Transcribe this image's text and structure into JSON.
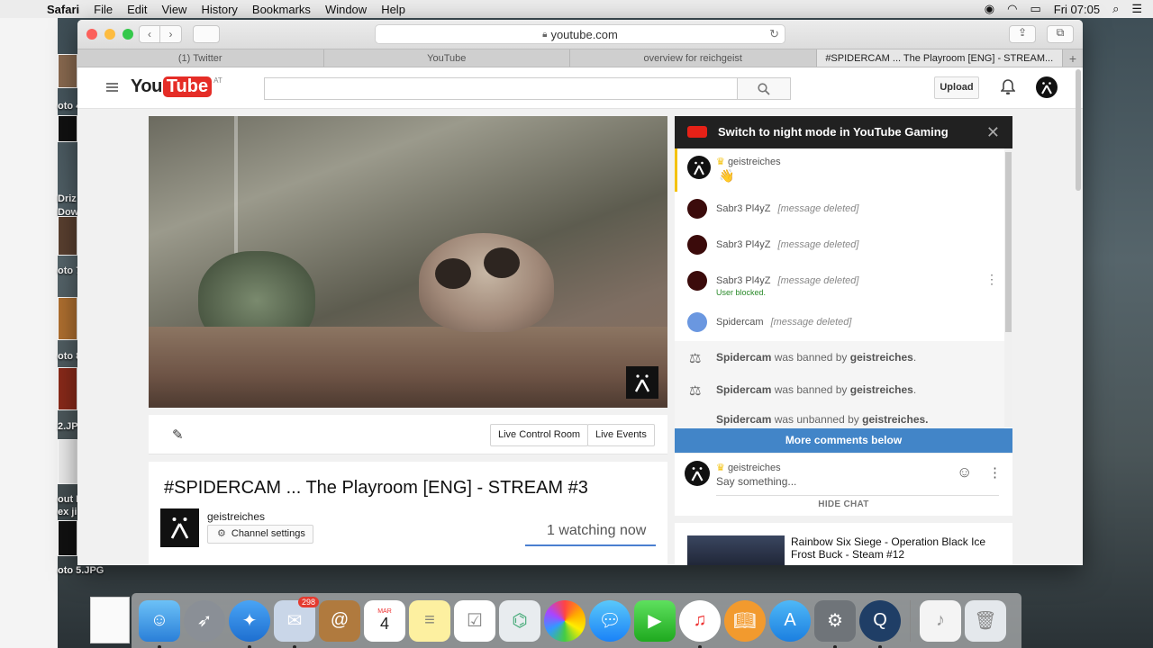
{
  "menubar": {
    "app": "Safari",
    "items": [
      "File",
      "Edit",
      "View",
      "History",
      "Bookmarks",
      "Window",
      "Help"
    ],
    "clock": "Fri 07:05"
  },
  "desktop": {
    "labels": [
      "oto 4",
      "Driz",
      "Dow",
      "oto 7",
      "oto 8",
      "2.JPG",
      "out I",
      "ex ji",
      "oto 5.JPG"
    ]
  },
  "browser": {
    "url": "youtube.com",
    "tabs": [
      "(1) Twitter",
      "YouTube",
      "overview for reichgeist",
      "#SPIDERCAM ... The Playroom [ENG] - STREAM..."
    ],
    "new_tab": "+"
  },
  "youtube": {
    "logo_you": "You",
    "logo_tube": "Tube",
    "logo_region": "AT",
    "search_placeholder": "",
    "upload_label": "Upload"
  },
  "video": {
    "title": "#SPIDERCAM ... The Playroom [ENG] - STREAM #3",
    "channel": "geistreiches",
    "channel_settings": "Channel settings",
    "watching": "1 watching now",
    "live_control_room": "Live Control Room",
    "live_events": "Live Events"
  },
  "chat": {
    "banner": "Switch to night mode in YouTube Gaming",
    "messages": [
      {
        "author": "geistreiches",
        "text": "",
        "emoji": "👋"
      },
      {
        "author": "Sabr3 Pl4yZ",
        "text": "[message deleted]"
      },
      {
        "author": "Sabr3 Pl4yZ",
        "text": "[message deleted]"
      },
      {
        "author": "Sabr3 Pl4yZ",
        "text": "[message deleted]",
        "note": "User blocked."
      },
      {
        "author": "Spidercam",
        "text": "[message deleted]"
      }
    ],
    "system": [
      {
        "user": "Spidercam",
        "action": "was banned by",
        "by": "geistreiches"
      },
      {
        "user": "Spidercam",
        "action": "was banned by",
        "by": "geistreiches"
      },
      {
        "user": "Spidercam",
        "action": "was unbanned by",
        "by": "geistreiches."
      }
    ],
    "more_comments": "More comments below",
    "input_author": "geistreiches",
    "input_placeholder": "Say something...",
    "hide_chat": "HIDE CHAT"
  },
  "recommendation": {
    "title_line1": "Rainbow Six Siege - Operation Black Ice",
    "title_line2": "Frost Buck - Steam #12"
  },
  "dock": {
    "mail_badge": "298",
    "calendar_month": "MAR",
    "calendar_day": "4"
  }
}
